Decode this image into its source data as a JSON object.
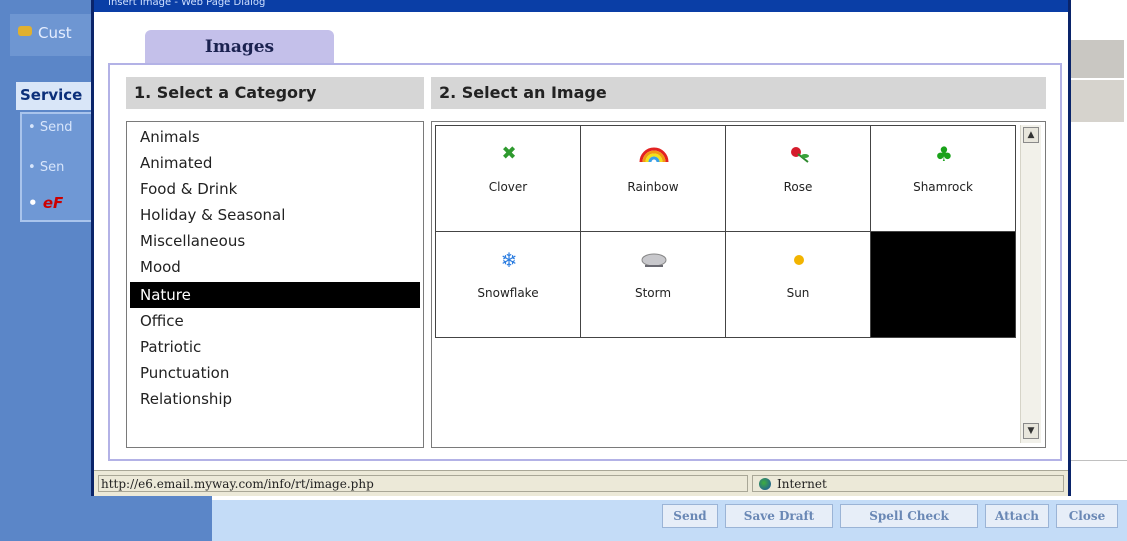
{
  "background": {
    "nav_top_label": "Cust",
    "service_label": "Service",
    "service_items": [
      "Send",
      "Sen"
    ],
    "logo_text": "eF",
    "bottom_buttons": {
      "send": "Send",
      "save_draft": "Save Draft",
      "spell_check": "Spell Check",
      "attach": "Attach",
      "close": "Close"
    }
  },
  "popup": {
    "title": "Insert Image - Web Page Dialog",
    "tab_label": "Images",
    "category_header": "1. Select a Category",
    "image_header": "2. Select an Image",
    "categories": [
      "Animals",
      "Animated",
      "Food & Drink",
      "Holiday & Seasonal",
      "Miscellaneous",
      "Mood",
      "Nature",
      "Office",
      "Patriotic",
      "Punctuation",
      "Relationship"
    ],
    "selected_category": "Nature",
    "images": [
      {
        "label": "Clover",
        "icon": "clover-icon"
      },
      {
        "label": "Rainbow",
        "icon": "rainbow-icon"
      },
      {
        "label": "Rose",
        "icon": "rose-icon"
      },
      {
        "label": "Shamrock",
        "icon": "shamrock-icon"
      },
      {
        "label": "Snowflake",
        "icon": "snowflake-icon"
      },
      {
        "label": "Storm",
        "icon": "storm-icon"
      },
      {
        "label": "Sun",
        "icon": "sun-icon"
      }
    ],
    "status_url": "http://e6.email.myway.com/info/rt/image.php",
    "status_zone": "Internet"
  }
}
